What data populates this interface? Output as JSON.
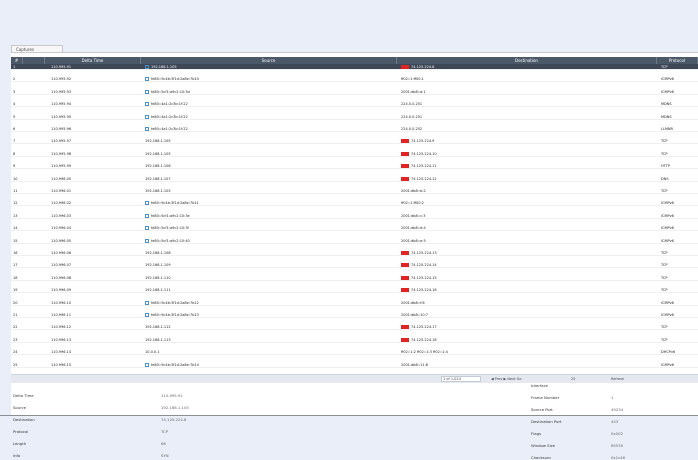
{
  "tab": {
    "label": "Captures"
  },
  "columns": [
    "#",
    "",
    "Delta Time",
    "Source",
    "Destination",
    "Protocol"
  ],
  "rows": [
    {
      "num": "1",
      "time": "110.995.91",
      "source": "192.168.1.105",
      "dest": "74.125.224.8",
      "proto": "TCP",
      "src_icon": true,
      "dst_flag": true,
      "selected": true
    },
    {
      "num": "2",
      "time": "110.995.92",
      "source": "fe80::9c4b:3f1d:2a8e:7b10",
      "dest": "ff02::1:ff00:1",
      "proto": "ICMPv6",
      "src_icon": true
    },
    {
      "num": "3",
      "time": "110.995.93",
      "source": "fe80::5cf1:a9c2:10:3d",
      "dest": "2001:db8::a:1",
      "proto": "ICMPv6",
      "src_icon": true
    },
    {
      "num": "4",
      "time": "110.995.94",
      "source": "fe80::4a1:2c3b:1f:22",
      "dest": "224.0.0.251",
      "proto": "MDNS",
      "src_icon": true
    },
    {
      "num": "5",
      "time": "110.995.95",
      "source": "fe80::4a1:2c3b:1f:22",
      "dest": "224.0.0.251",
      "proto": "MDNS",
      "src_icon": true
    },
    {
      "num": "6",
      "time": "110.995.96",
      "source": "fe80::4a1:2c3b:1f:22",
      "dest": "224.0.0.252",
      "proto": "LLMNR",
      "src_icon": true
    },
    {
      "num": "7",
      "time": "110.995.97",
      "source": "192.168.1.105",
      "dest": "74.125.224.9",
      "proto": "TCP",
      "dst_flag": true
    },
    {
      "num": "8",
      "time": "110.995.98",
      "source": "192.168.1.105",
      "dest": "74.125.224.10",
      "proto": "TCP",
      "dst_flag": true
    },
    {
      "num": "9",
      "time": "110.995.99",
      "source": "192.168.1.106",
      "dest": "74.125.224.11",
      "proto": "HTTP",
      "dst_flag": true
    },
    {
      "num": "10",
      "time": "110.996.00",
      "source": "192.168.1.107",
      "dest": "74.125.224.12",
      "proto": "DNS",
      "dst_flag": true
    },
    {
      "num": "11",
      "time": "110.996.01",
      "source": "192.168.1.105",
      "dest": "2001:db8::b:2",
      "proto": "TCP"
    },
    {
      "num": "12",
      "time": "110.996.02",
      "source": "fe80::9c4b:3f1d:2a8e:7b11",
      "dest": "ff02::1:ff00:2",
      "proto": "ICMPv6",
      "src_icon": true
    },
    {
      "num": "13",
      "time": "110.996.03",
      "source": "fe80::5cf1:a9c2:10:3e",
      "dest": "2001:db8::c:3",
      "proto": "ICMPv6",
      "src_icon": true
    },
    {
      "num": "14",
      "time": "110.996.04",
      "source": "fe80::5cf1:a9c2:10:3f",
      "dest": "2001:db8::d:4",
      "proto": "ICMPv6",
      "src_icon": true
    },
    {
      "num": "15",
      "time": "110.996.05",
      "source": "fe80::5cf1:a9c2:10:40",
      "dest": "2001:db8::e:5",
      "proto": "ICMPv6",
      "src_icon": true
    },
    {
      "num": "16",
      "time": "110.996.06",
      "source": "192.168.1.108",
      "dest": "74.125.224.13",
      "proto": "TCP",
      "dst_flag": true
    },
    {
      "num": "17",
      "time": "110.996.07",
      "source": "192.168.1.109",
      "dest": "74.125.224.14",
      "proto": "TCP",
      "dst_flag": true
    },
    {
      "num": "18",
      "time": "110.996.08",
      "source": "192.168.1.110",
      "dest": "74.125.224.15",
      "proto": "TCP",
      "dst_flag": true
    },
    {
      "num": "19",
      "time": "110.996.09",
      "source": "192.168.1.111",
      "dest": "74.125.224.16",
      "proto": "TCP",
      "dst_flag": true
    },
    {
      "num": "20",
      "time": "110.996.10",
      "source": "fe80::9c4b:3f1d:2a8e:7b12",
      "dest": "2001:db8::f:6",
      "proto": "ICMPv6",
      "src_icon": true
    },
    {
      "num": "21",
      "time": "110.996.11",
      "source": "fe80::9c4b:3f1d:2a8e:7b13",
      "dest": "2001:db8::10:7",
      "proto": "ICMPv6",
      "src_icon": true
    },
    {
      "num": "22",
      "time": "110.996.12",
      "source": "192.168.1.112",
      "dest": "74.125.224.17",
      "proto": "TCP",
      "dst_flag": true
    },
    {
      "num": "23",
      "time": "110.996.13",
      "source": "192.168.1.113",
      "dest": "74.125.224.18",
      "proto": "TCP",
      "dst_flag": true
    },
    {
      "num": "24",
      "time": "110.996.14",
      "source": "10.0.0.1",
      "dest": "ff02::1:2 ff02::1:3 ff02::1:4",
      "proto": "DHCPv6"
    },
    {
      "num": "25",
      "time": "110.996.15",
      "source": "fe80::9c4b:3f1d:2a8e:7b14",
      "dest": "2001:db8::11:8",
      "proto": "ICMPv6",
      "src_icon": true
    }
  ],
  "pager": {
    "page_info": "1 of 1,024",
    "controls": "◀ Prev  ▶  Next  Go",
    "per_page": "25",
    "refresh": "Refresh"
  },
  "details_left": [
    {
      "label": "Delta Time",
      "value": "110.995.91"
    },
    {
      "label": "Source",
      "value": "192.168.1.105"
    },
    {
      "label": "Destination",
      "value": "74.125.224.8"
    },
    {
      "label": "Protocol",
      "value": "TCP"
    },
    {
      "label": "Length",
      "value": "66"
    },
    {
      "label": "Info",
      "value": "SYN"
    }
  ],
  "details_right": [
    {
      "label": "Interface",
      "value": ""
    },
    {
      "label": "Frame Number",
      "value": "1"
    },
    {
      "label": "Source Port",
      "value": "49234"
    },
    {
      "label": "Destination Port",
      "value": "443"
    },
    {
      "label": "Flags",
      "value": "0x002"
    },
    {
      "label": "Window Size",
      "value": "65535"
    },
    {
      "label": "Checksum",
      "value": "0x1c46"
    }
  ],
  "colors": {
    "header_bg": "#4b5868",
    "selected_bg": "#3d4756",
    "flag": "#e02424",
    "page_bg": "#e9eef8"
  }
}
